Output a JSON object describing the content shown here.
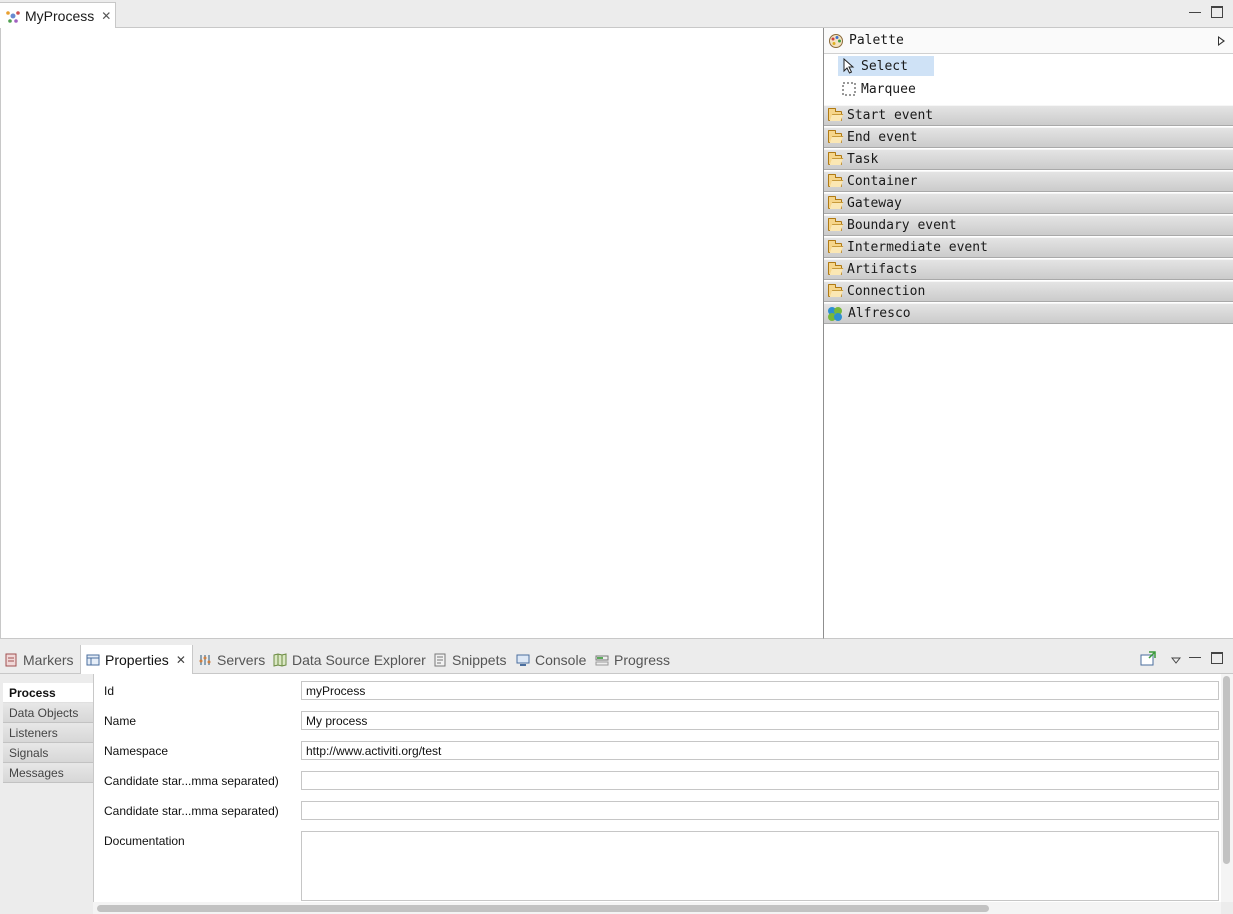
{
  "editor": {
    "tab_label": "MyProcess",
    "tab_icon": "process-icon"
  },
  "palette": {
    "title": "Palette",
    "tools": [
      {
        "label": "Select",
        "icon": "cursor-arrow-icon",
        "selected": true
      },
      {
        "label": "Marquee",
        "icon": "marquee-icon",
        "selected": false
      }
    ],
    "drawers": [
      {
        "label": "Start event",
        "icon": "folder-icon"
      },
      {
        "label": "End event",
        "icon": "folder-icon"
      },
      {
        "label": "Task",
        "icon": "folder-icon"
      },
      {
        "label": "Container",
        "icon": "folder-icon"
      },
      {
        "label": "Gateway",
        "icon": "folder-icon"
      },
      {
        "label": "Boundary event",
        "icon": "folder-icon"
      },
      {
        "label": "Intermediate event",
        "icon": "folder-icon"
      },
      {
        "label": "Artifacts",
        "icon": "folder-icon"
      },
      {
        "label": "Connection",
        "icon": "folder-icon"
      },
      {
        "label": "Alfresco",
        "icon": "alfresco-icon"
      }
    ]
  },
  "views": {
    "tabs": [
      {
        "label": "Markers",
        "icon": "markers-icon",
        "active": false
      },
      {
        "label": "Properties",
        "icon": "properties-icon",
        "active": true
      },
      {
        "label": "Servers",
        "icon": "servers-icon",
        "active": false
      },
      {
        "label": "Data Source Explorer",
        "icon": "data-source-icon",
        "active": false
      },
      {
        "label": "Snippets",
        "icon": "snippets-icon",
        "active": false
      },
      {
        "label": "Console",
        "icon": "console-icon",
        "active": false
      },
      {
        "label": "Progress",
        "icon": "progress-icon",
        "active": false
      }
    ]
  },
  "properties": {
    "sections": [
      {
        "label": "Process",
        "active": true
      },
      {
        "label": "Data Objects",
        "active": false
      },
      {
        "label": "Listeners",
        "active": false
      },
      {
        "label": "Signals",
        "active": false
      },
      {
        "label": "Messages",
        "active": false
      }
    ],
    "fields": {
      "id": {
        "label": "Id",
        "value": "myProcess"
      },
      "name": {
        "label": "Name",
        "value": "My process"
      },
      "namespace": {
        "label": "Namespace",
        "value": "http://www.activiti.org/test"
      },
      "candidate_users": {
        "label": "Candidate star...mma separated)",
        "value": ""
      },
      "candidate_groups": {
        "label": "Candidate star...mma separated)",
        "value": ""
      },
      "documentation": {
        "label": "Documentation",
        "value": ""
      }
    }
  }
}
